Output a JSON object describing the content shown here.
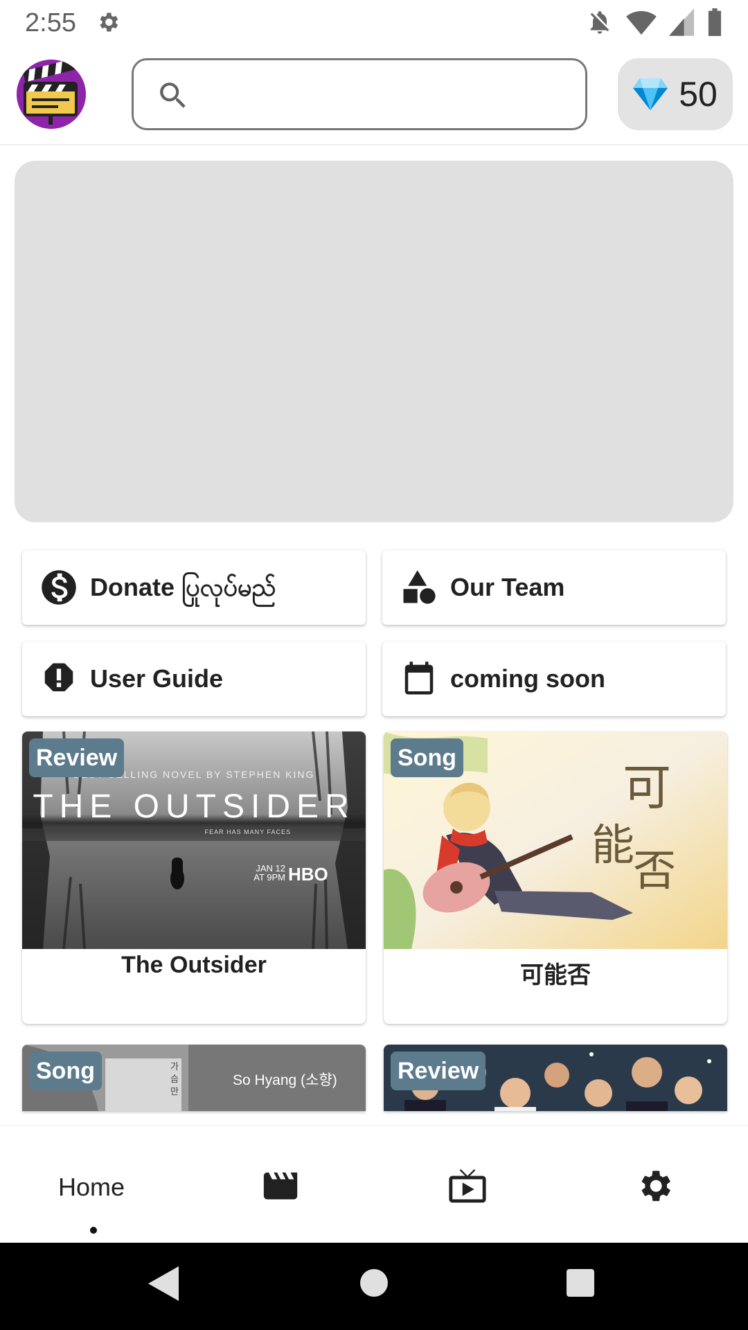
{
  "status_bar": {
    "time": "2:55"
  },
  "header": {
    "search_placeholder": "",
    "coin_count": "50"
  },
  "menu": [
    {
      "label": "Donate ပြုလုပ်မည်",
      "icon": "dollar-icon"
    },
    {
      "label": "Our Team",
      "icon": "shapes-icon"
    },
    {
      "label": "User Guide",
      "icon": "alert-octagon-icon"
    },
    {
      "label": "coming soon",
      "icon": "calendar-icon"
    }
  ],
  "cards": [
    {
      "tag": "Review",
      "title": "The Outsider",
      "poster": {
        "tagline": "BEST-SELLING NOVEL BY STEPHEN KING",
        "headline": "THE OUTSIDER",
        "subline": "FEAR HAS MANY FACES",
        "date_line1": "JAN 12",
        "date_line2": "AT 9PM",
        "network": "HBO"
      }
    },
    {
      "tag": "Song",
      "title": "可能否",
      "poster": {
        "calligraphy": "可能否"
      }
    },
    {
      "tag": "Song",
      "title": "",
      "poster": {
        "artist": "So Hyang (소향)"
      }
    },
    {
      "tag": "Review",
      "title": ""
    }
  ],
  "bottom_nav": {
    "home_label": "Home"
  },
  "colors": {
    "tag_bg": "#5c7b8c",
    "banner_bg": "#e0e0e0",
    "coin_bg": "#e3e3e3",
    "logo_bg": "#8e24aa"
  }
}
